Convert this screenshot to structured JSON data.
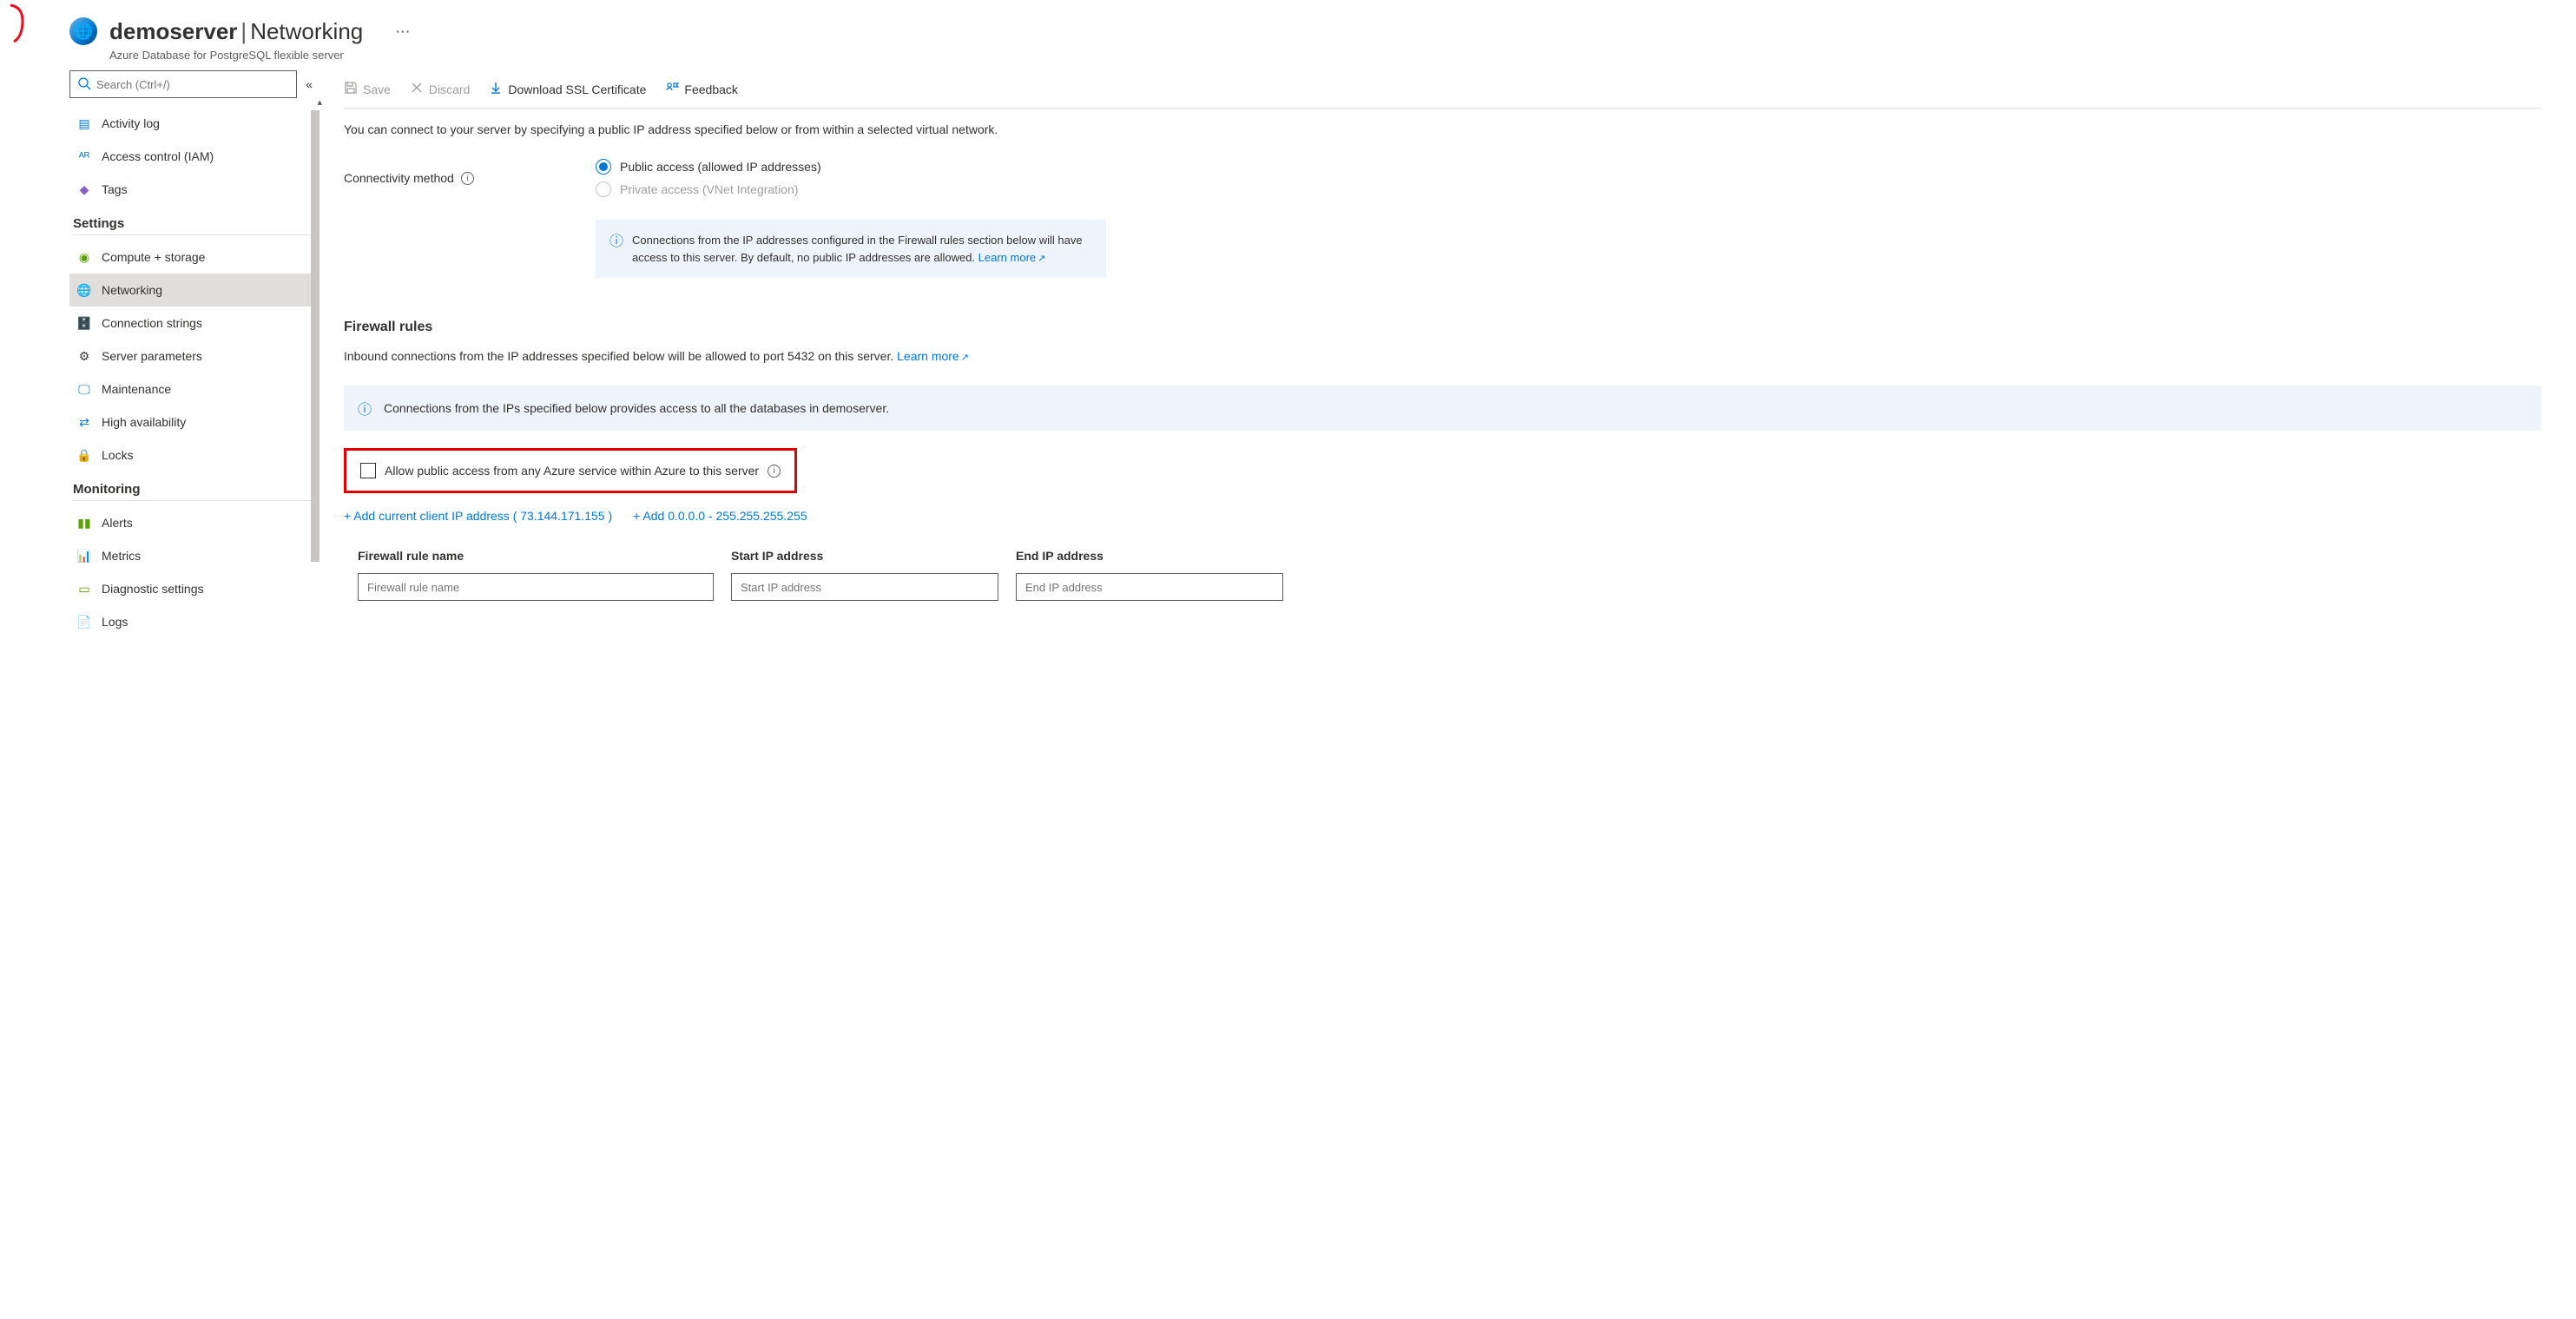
{
  "header": {
    "server_name": "demoserver",
    "page_title": "Networking",
    "more": "···",
    "subtitle": "Azure Database for PostgreSQL flexible server"
  },
  "sidebar": {
    "search_placeholder": "Search (Ctrl+/)",
    "top": [
      {
        "label": "Activity log"
      },
      {
        "label": "Access control (IAM)"
      },
      {
        "label": "Tags"
      }
    ],
    "settings_title": "Settings",
    "settings": [
      {
        "label": "Compute + storage"
      },
      {
        "label": "Networking"
      },
      {
        "label": "Connection strings"
      },
      {
        "label": "Server parameters"
      },
      {
        "label": "Maintenance"
      },
      {
        "label": "High availability"
      },
      {
        "label": "Locks"
      }
    ],
    "monitoring_title": "Monitoring",
    "monitoring": [
      {
        "label": "Alerts"
      },
      {
        "label": "Metrics"
      },
      {
        "label": "Diagnostic settings"
      },
      {
        "label": "Logs"
      }
    ]
  },
  "toolbar": {
    "save": "Save",
    "discard": "Discard",
    "download_cert": "Download SSL Certificate",
    "feedback": "Feedback"
  },
  "main": {
    "intro": "You can connect to your server by specifying a public IP address specified below or from within a selected virtual network.",
    "connectivity_label": "Connectivity method",
    "radio_public": "Public access (allowed IP addresses)",
    "radio_private": "Private access (VNet Integration)",
    "info_box": "Connections from the IP addresses configured in the Firewall rules section below will have access to this server. By default, no public IP addresses are allowed. ",
    "info_box_link": "Learn more",
    "firewall_title": "Firewall rules",
    "firewall_desc": "Inbound connections from the IP addresses specified below will be allowed to port 5432 on this server. ",
    "firewall_desc_link": "Learn more",
    "firewall_banner": "Connections from the IPs specified below provides access to all the databases in demoserver.",
    "allow_azure_label": "Allow public access from any Azure service within Azure to this server",
    "add_client_ip": "+ Add current client IP address ( 73.144.171.155 )",
    "add_all_ips": "+ Add 0.0.0.0 - 255.255.255.255",
    "col_rule_name": "Firewall rule name",
    "col_start_ip": "Start IP address",
    "col_end_ip": "End IP address",
    "ph_rule_name": "Firewall rule name",
    "ph_start_ip": "Start IP address",
    "ph_end_ip": "End IP address"
  }
}
